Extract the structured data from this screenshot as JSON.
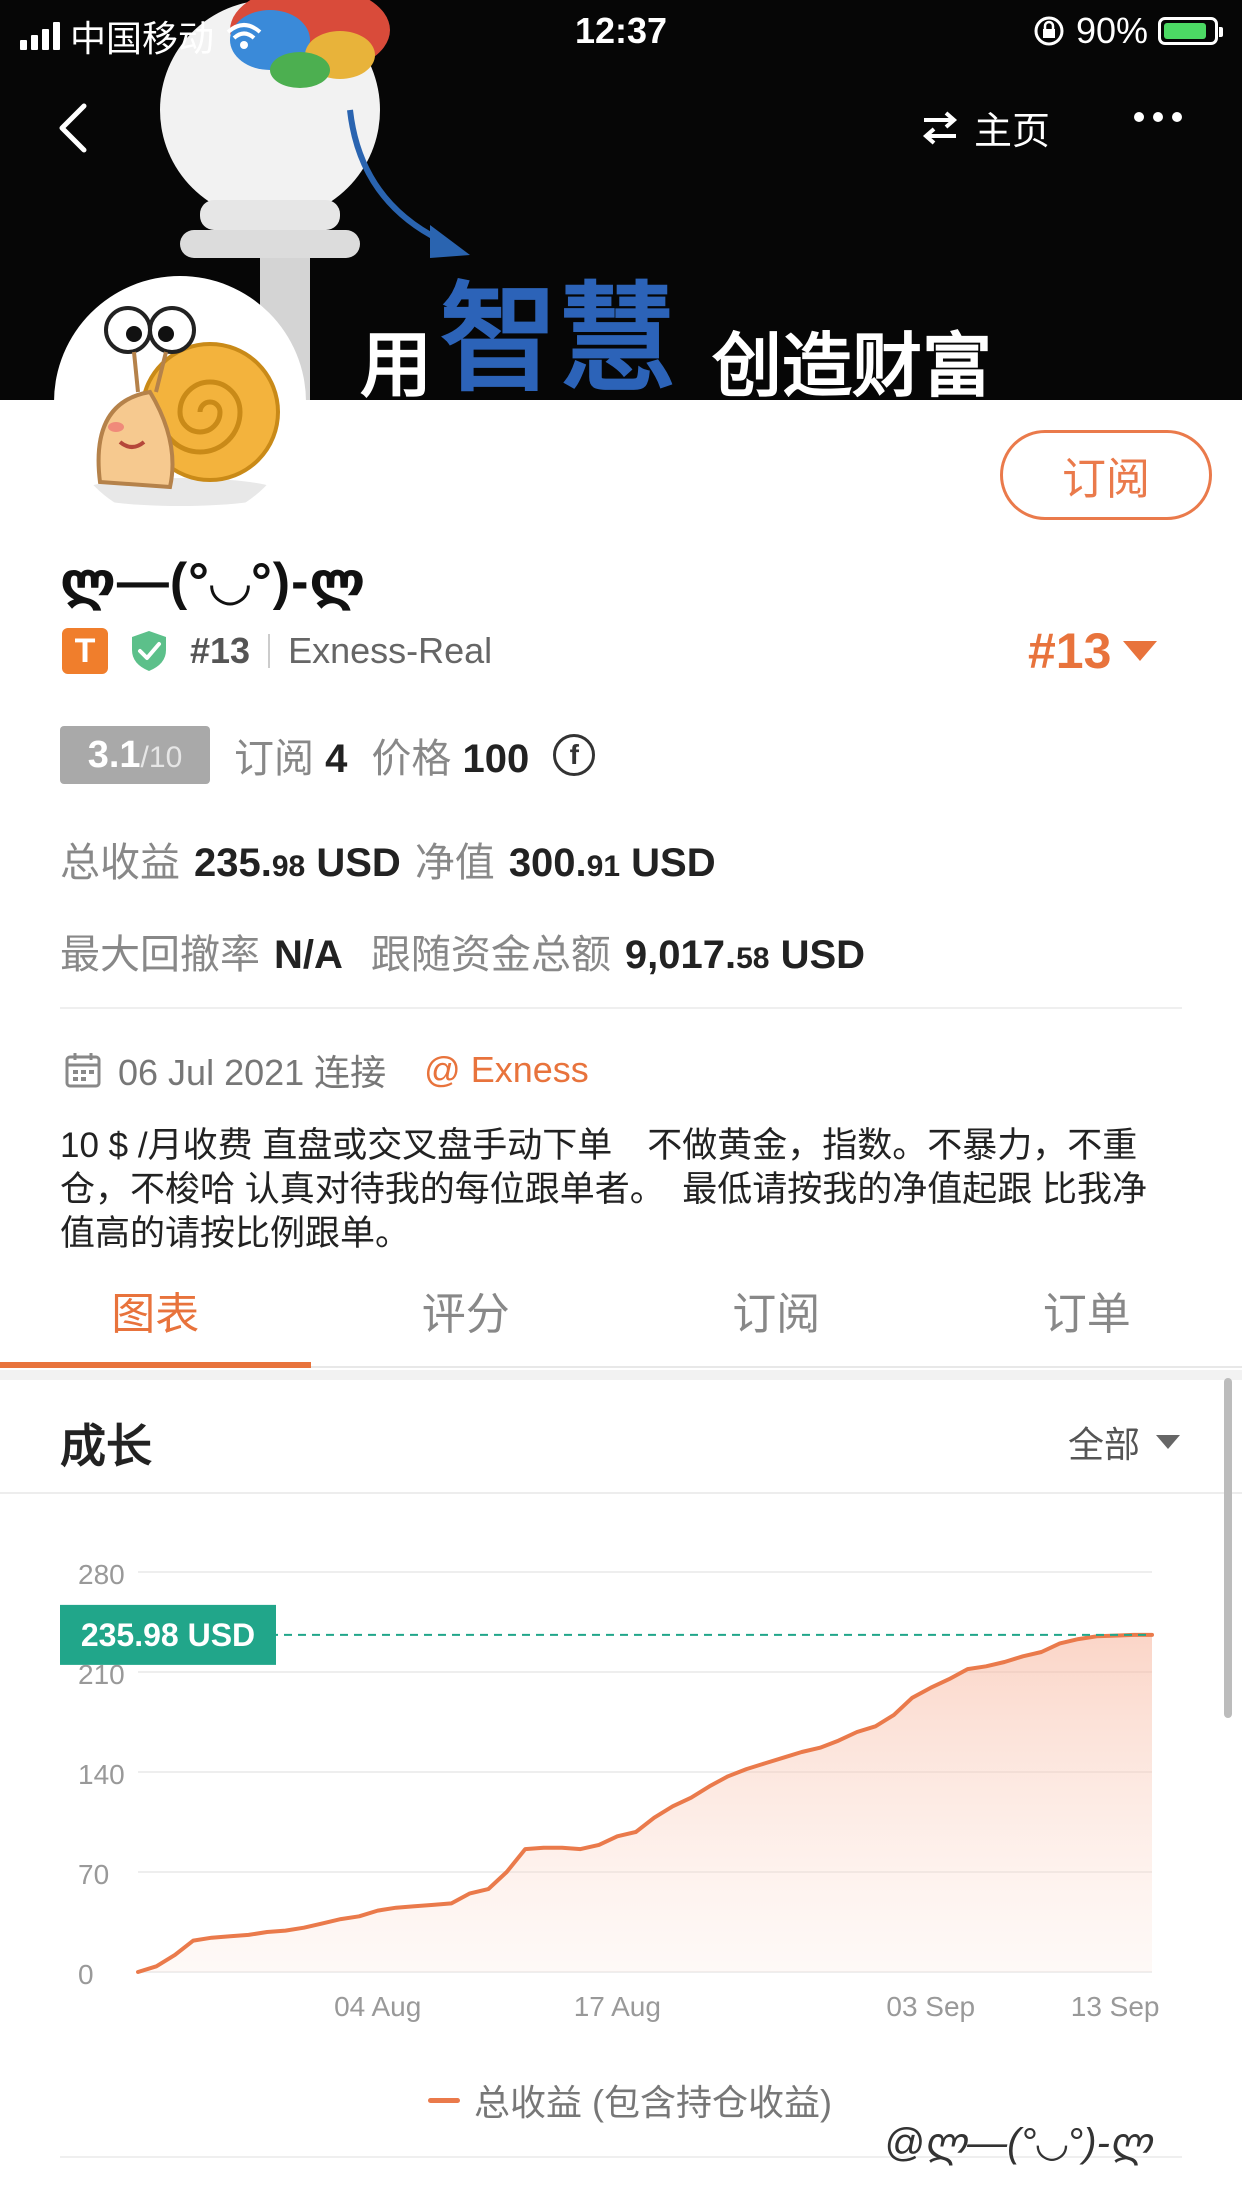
{
  "status_bar": {
    "carrier": "中国移动",
    "time": "12:37",
    "battery": "90%"
  },
  "nav": {
    "home_label": "主页"
  },
  "banner": {
    "text_pre": "用",
    "text_main": "智慧",
    "text_post": "创造财富"
  },
  "profile": {
    "subscribe_label": "订阅",
    "username": "ლ—(°◡°)-ლ",
    "t_badge": "T",
    "rank_small": "#13",
    "broker": "Exness-Real",
    "rank_big": "#13"
  },
  "stats": {
    "score_main": "3.1",
    "score_sub": "/10",
    "subscriptions_label": "订阅",
    "subscriptions_value": "4",
    "price_label": "价格",
    "price_value": "100",
    "price_coin": "f",
    "total_profit_label": "总收益",
    "total_profit_int": "235.",
    "total_profit_dec": "98",
    "total_profit_unit": "USD",
    "equity_label": "净值",
    "equity_int": "300.",
    "equity_dec": "91",
    "equity_unit": "USD",
    "drawdown_label": "最大回撤率",
    "drawdown_value": "N/A",
    "follow_label": "跟随资金总额",
    "follow_int": "9,017.",
    "follow_dec": "58",
    "follow_unit": "USD"
  },
  "connect": {
    "date_text": "06 Jul 2021 连接",
    "broker_link": "@ Exness"
  },
  "bio": "10 $ /月收费 直盘或交叉盘手动下单　不做黄金，指数。不暴力，不重仓，不梭哈 认真对待我的每位跟单者。　最低请按我的净值起跟 比我净值高的请按比例跟单。",
  "tabs": [
    "图表",
    "评分",
    "订阅",
    "订单"
  ],
  "section": {
    "title": "成长",
    "range": "全部"
  },
  "chart_data": {
    "type": "area",
    "title": "",
    "xlabel": "",
    "ylabel": "",
    "yticks": [
      0,
      70,
      140,
      210,
      280
    ],
    "ylim": [
      0,
      280
    ],
    "xtick_labels": [
      "04 Aug",
      "17 Aug",
      "03 Sep",
      "13 Sep"
    ],
    "x": [
      "22 Jul",
      "23 Jul",
      "24 Jul",
      "25 Jul",
      "26 Jul",
      "27 Jul",
      "28 Jul",
      "29 Jul",
      "30 Jul",
      "31 Jul",
      "01 Aug",
      "02 Aug",
      "03 Aug",
      "04 Aug",
      "05 Aug",
      "06 Aug",
      "07 Aug",
      "08 Aug",
      "09 Aug",
      "10 Aug",
      "11 Aug",
      "12 Aug",
      "13 Aug",
      "14 Aug",
      "15 Aug",
      "16 Aug",
      "17 Aug",
      "18 Aug",
      "19 Aug",
      "20 Aug",
      "21 Aug",
      "22 Aug",
      "23 Aug",
      "24 Aug",
      "25 Aug",
      "26 Aug",
      "27 Aug",
      "28 Aug",
      "29 Aug",
      "30 Aug",
      "31 Aug",
      "01 Sep",
      "02 Sep",
      "03 Sep",
      "04 Sep",
      "05 Sep",
      "06 Sep",
      "07 Sep",
      "08 Sep",
      "09 Sep",
      "10 Sep",
      "11 Sep",
      "12 Sep",
      "13 Sep",
      "14 Sep",
      "15 Sep"
    ],
    "series": [
      {
        "name": "总收益 (包含持仓收益)",
        "values": [
          0,
          4,
          12,
          22,
          24,
          25,
          26,
          28,
          29,
          31,
          34,
          37,
          39,
          43,
          45,
          46,
          47,
          48,
          55,
          58,
          70,
          86,
          87,
          87,
          86,
          89,
          95,
          98,
          108,
          116,
          122,
          130,
          137,
          142,
          146,
          150,
          154,
          157,
          162,
          168,
          172,
          180,
          192,
          199,
          205,
          212,
          214,
          217,
          221,
          224,
          230,
          233,
          235,
          235.5,
          235.98,
          235.98
        ]
      }
    ],
    "current_value_label": "235.98 USD",
    "current_value": 235.98,
    "line_color": "#ea7a4b",
    "marker_color": "#21a68a"
  },
  "watermark": "@ლ—(°◡°)-ლ"
}
